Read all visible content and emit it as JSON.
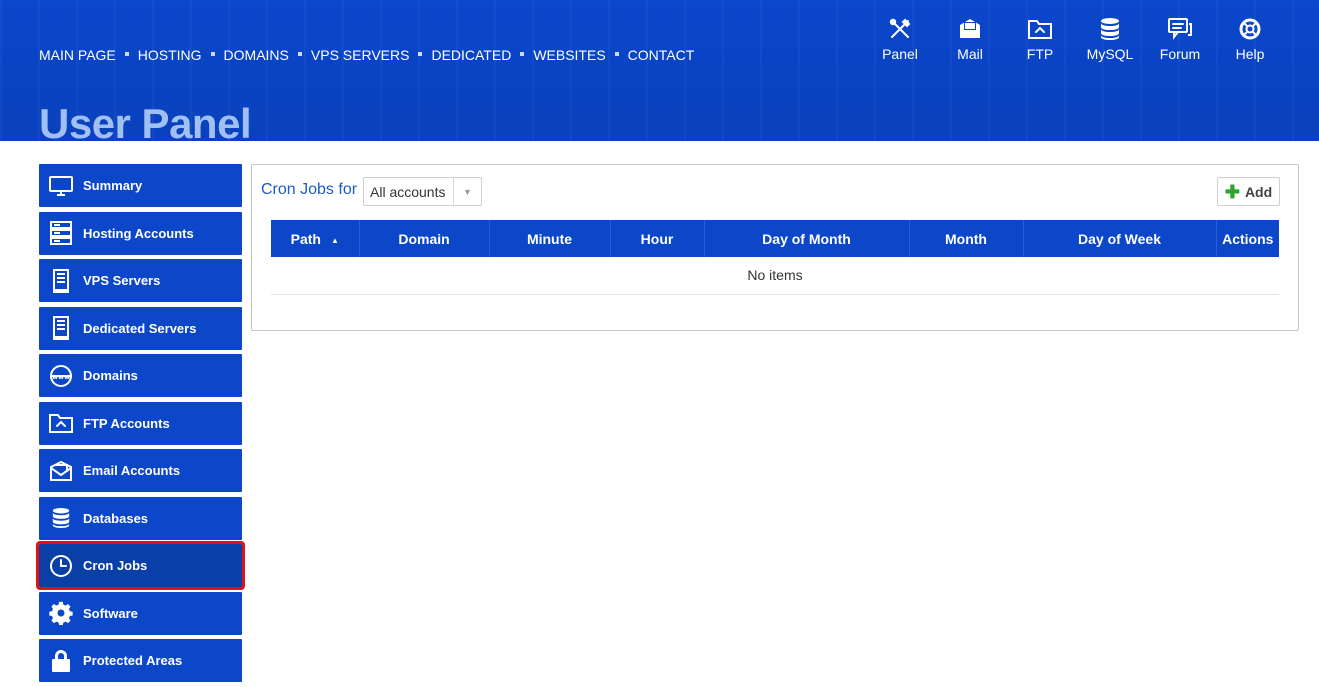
{
  "nav": {
    "links": [
      "MAIN PAGE",
      "HOSTING",
      "DOMAINS",
      "VPS SERVERS",
      "DEDICATED",
      "WEBSITES",
      "CONTACT"
    ]
  },
  "topicons": [
    {
      "label": "Panel",
      "icon": "tools-icon"
    },
    {
      "label": "Mail",
      "icon": "mail-icon"
    },
    {
      "label": "FTP",
      "icon": "ftp-folder-icon"
    },
    {
      "label": "MySQL",
      "icon": "database-icon"
    },
    {
      "label": "Forum",
      "icon": "forum-icon"
    },
    {
      "label": "Help",
      "icon": "lifebuoy-icon"
    }
  ],
  "page_title": "User Panel",
  "sidebar": {
    "items": [
      {
        "label": "Summary",
        "icon": "monitor-icon"
      },
      {
        "label": "Hosting Accounts",
        "icon": "server-rack-icon"
      },
      {
        "label": "VPS Servers",
        "icon": "vps-server-icon"
      },
      {
        "label": "Dedicated Servers",
        "icon": "dedicated-server-icon"
      },
      {
        "label": "Domains",
        "icon": "www-globe-icon"
      },
      {
        "label": "FTP Accounts",
        "icon": "ftp-folder-icon"
      },
      {
        "label": "Email Accounts",
        "icon": "email-icon"
      },
      {
        "label": "Databases",
        "icon": "database-icon"
      },
      {
        "label": "Cron Jobs",
        "icon": "clock-icon",
        "active": true
      },
      {
        "label": "Software",
        "icon": "gear-icon"
      },
      {
        "label": "Protected Areas",
        "icon": "lock-icon"
      }
    ]
  },
  "main": {
    "title": "Cron Jobs for",
    "account_select": {
      "value": "All accounts"
    },
    "add_label": "Add",
    "columns": [
      "Path",
      "Domain",
      "Minute",
      "Hour",
      "Day of Month",
      "Month",
      "Day of Week",
      "Actions"
    ],
    "empty_text": "No items"
  },
  "colors": {
    "brand_blue": "#0b47c8",
    "active_outline": "#e0101a",
    "title_light_blue": "#9fc0f0",
    "add_plus": "#2aa52a"
  }
}
